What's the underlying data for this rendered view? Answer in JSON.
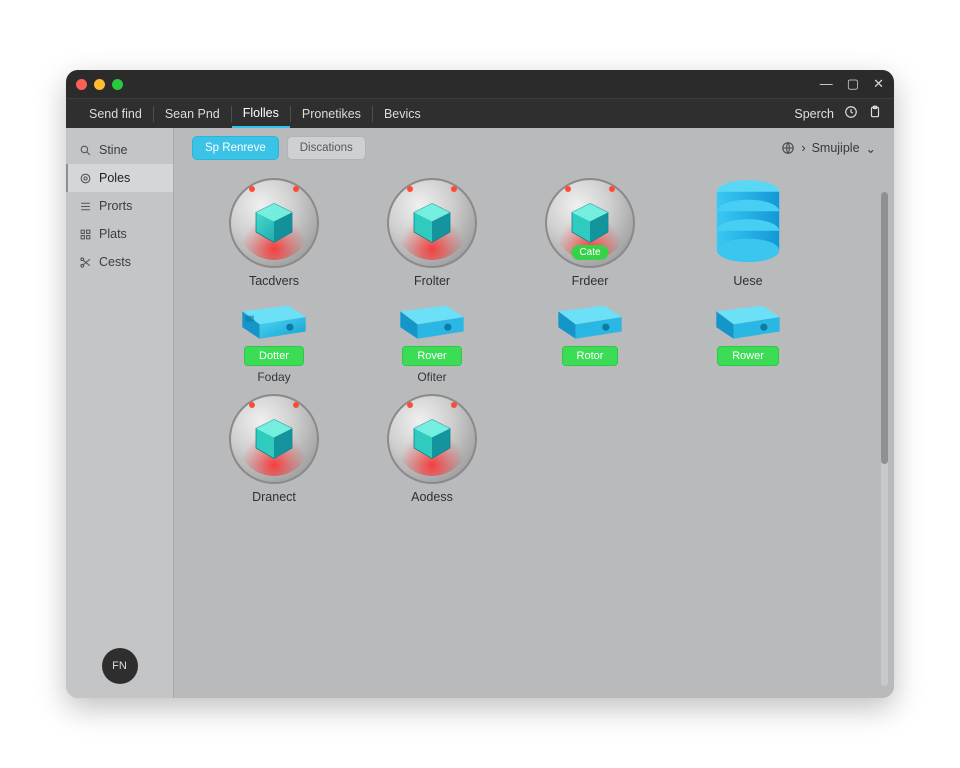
{
  "window": {
    "controls": {
      "min": "—",
      "max": "▢",
      "close": "✕"
    }
  },
  "menu": {
    "items": [
      "Send find",
      "Sean Pnd",
      "Flolles",
      "Pronetikes",
      "Bevics"
    ],
    "active_index": 2,
    "search_label": "Sperch"
  },
  "sidebar": {
    "items": [
      {
        "label": "Stine",
        "icon": "search"
      },
      {
        "label": "Poles",
        "icon": "target"
      },
      {
        "label": "Prorts",
        "icon": "list"
      },
      {
        "label": "Plats",
        "icon": "grid"
      },
      {
        "label": "Cests",
        "icon": "scissors"
      }
    ],
    "selected_index": 1,
    "fab_label": "FN"
  },
  "toolbar": {
    "primary_label": "Sp Renreve",
    "secondary_label": "Discations",
    "view_label": "Smujiple"
  },
  "grid": {
    "row1": [
      {
        "label": "Tacdvers",
        "kind": "disc"
      },
      {
        "label": "Frolter",
        "kind": "disc"
      },
      {
        "label": "Frdeer",
        "kind": "disc",
        "tag": "Cate"
      },
      {
        "label": "Uese",
        "kind": "db"
      }
    ],
    "row2": [
      {
        "label": "Foday",
        "badge": "Dotter"
      },
      {
        "label": "Ofiter",
        "badge": "Rover"
      },
      {
        "label": "",
        "badge": "Rotor"
      },
      {
        "label": "",
        "badge": "Rower"
      }
    ],
    "row3": [
      {
        "label": "Dranect",
        "kind": "disc"
      },
      {
        "label": "Aodess",
        "kind": "disc"
      }
    ]
  }
}
